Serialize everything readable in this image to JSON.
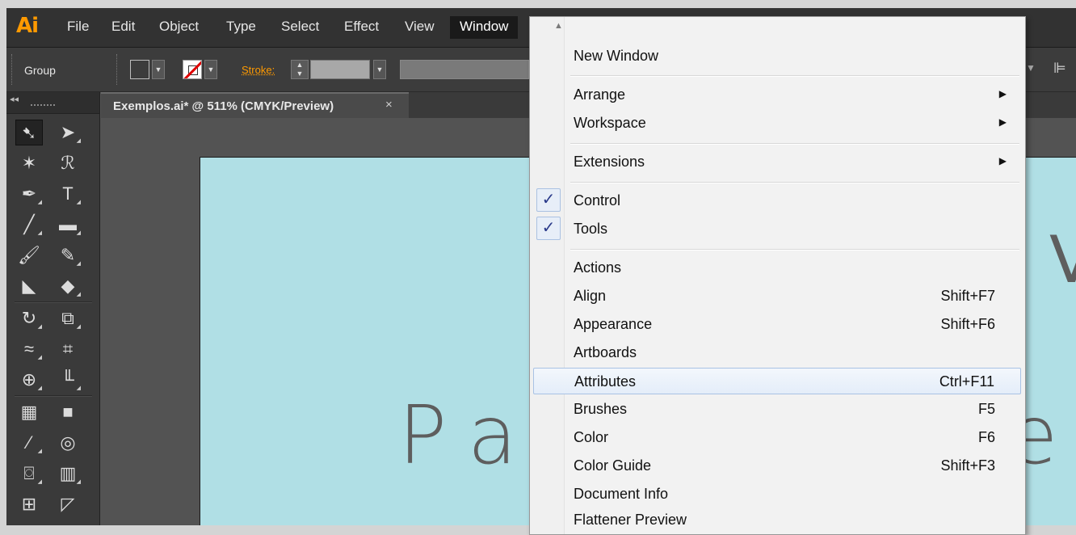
{
  "app": {
    "logo": "Ai"
  },
  "menubar": {
    "items": [
      "File",
      "Edit",
      "Object",
      "Type",
      "Select",
      "Effect",
      "View",
      "Window"
    ],
    "active": "Window"
  },
  "control": {
    "group_label": "Group",
    "stroke_label": "Stroke:"
  },
  "document": {
    "tab_title": "Exemplos.ai* @ 511% (CMYK/Preview)",
    "close_glyph": "×"
  },
  "artboard": {
    "background": "#b0dfe5",
    "text_left": "Pa",
    "text_right": "e",
    "text_top_right": "V"
  },
  "window_menu": {
    "items": [
      {
        "label": "New Window"
      },
      {
        "label": "Arrange",
        "submenu": true
      },
      {
        "label": "Workspace",
        "submenu": true
      },
      {
        "label": "Extensions",
        "submenu": true
      },
      {
        "label": "Control",
        "checked": true
      },
      {
        "label": "Tools",
        "checked": true
      },
      {
        "label": "Actions"
      },
      {
        "label": "Align",
        "shortcut": "Shift+F7"
      },
      {
        "label": "Appearance",
        "shortcut": "Shift+F6"
      },
      {
        "label": "Artboards"
      },
      {
        "label": "Attributes",
        "shortcut": "Ctrl+F11",
        "highlighted": true
      },
      {
        "label": "Brushes",
        "shortcut": "F5"
      },
      {
        "label": "Color",
        "shortcut": "F6"
      },
      {
        "label": "Color Guide",
        "shortcut": "Shift+F3"
      },
      {
        "label": "Document Info"
      },
      {
        "label": "Flattener Preview"
      }
    ]
  },
  "colors": {
    "accent_orange": "#ff9a00",
    "menu_highlight_border": "#a9c2e4",
    "check_color": "#2a3a8a"
  }
}
